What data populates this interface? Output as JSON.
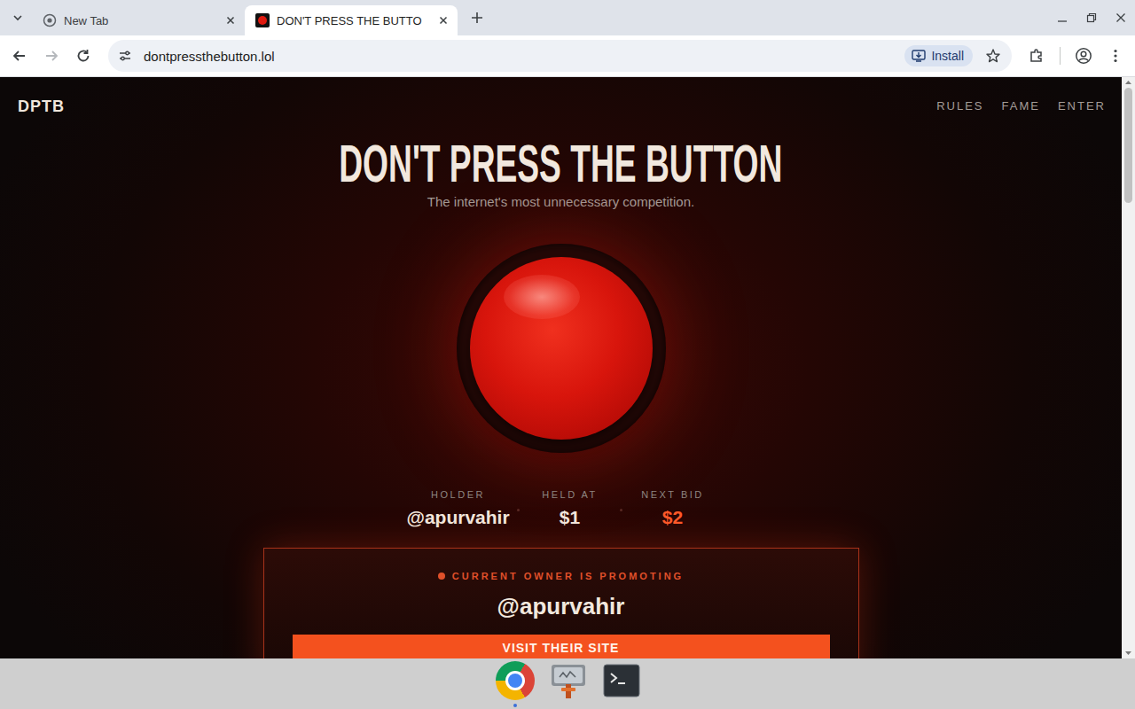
{
  "browser": {
    "tabs": [
      {
        "label": "New Tab",
        "selected": false,
        "kind": "newtab"
      },
      {
        "label": "DON'T PRESS THE BUTTO",
        "selected": true,
        "kind": "site"
      }
    ],
    "navigation": {
      "back_enabled": true,
      "forward_enabled": false
    },
    "url": "dontpressthebutton.lol",
    "install_label": "Install"
  },
  "page": {
    "logo": "DPTB",
    "nav": [
      "RULES",
      "FAME",
      "ENTER"
    ],
    "title": "DON'T PRESS THE BUTTON",
    "subtitle": "The internet's most unnecessary competition.",
    "stats": [
      {
        "label": "HOLDER",
        "value": "@apurvahir",
        "highlight": false
      },
      {
        "label": "HELD AT",
        "value": "$1",
        "highlight": false
      },
      {
        "label": "NEXT BID",
        "value": "$2",
        "highlight": true
      }
    ],
    "promo": {
      "heading": "CURRENT OWNER IS PROMOTING",
      "owner": "@apurvahir",
      "button": "VISIT THEIR SITE"
    }
  },
  "taskbar": {
    "apps": [
      {
        "kind": "browser",
        "active": true
      },
      {
        "kind": "app",
        "active": false
      },
      {
        "kind": "terminal",
        "active": false
      }
    ]
  }
}
